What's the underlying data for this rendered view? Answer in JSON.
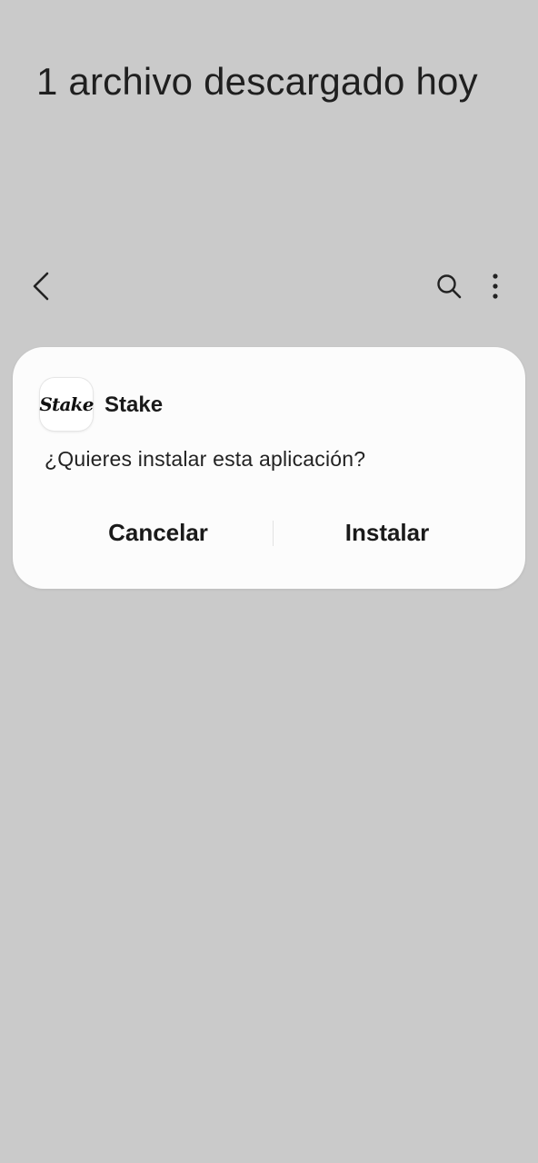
{
  "header": {
    "title": "1 archivo descargado hoy"
  },
  "toolbar": {
    "back_icon": "chevron-left-icon",
    "search_icon": "search-icon",
    "more_icon": "more-vertical-icon"
  },
  "dialog": {
    "app_icon_text": "Stake",
    "app_name": "Stake",
    "prompt": "¿Quieres instalar esta aplicación?",
    "cancel_label": "Cancelar",
    "install_label": "Instalar"
  },
  "colors": {
    "background": "#cacaca",
    "dialog": "#fcfcfc",
    "text": "#1a1a1a"
  }
}
